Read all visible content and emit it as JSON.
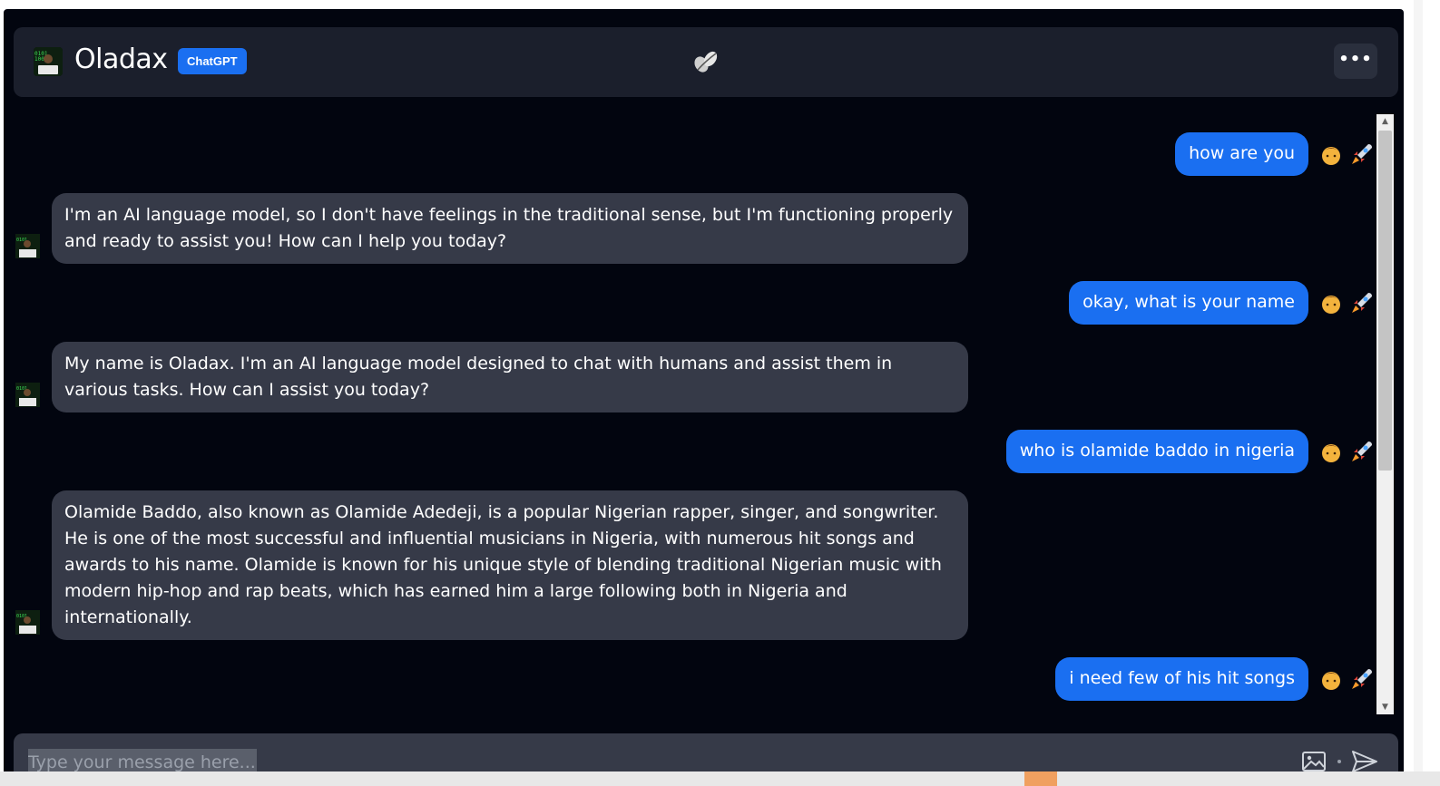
{
  "header": {
    "title": "Oladax",
    "badge": "ChatGPT",
    "menu_label": "•••"
  },
  "messages": [
    {
      "role": "user",
      "text": "how are you"
    },
    {
      "role": "bot",
      "text": "I'm an AI language model, so I don't have feelings in the traditional sense, but I'm functioning properly and ready to assist you! How can I help you today?"
    },
    {
      "role": "user",
      "text": "okay, what is your name"
    },
    {
      "role": "bot",
      "text": "My name is Oladax. I'm an AI language model designed to chat with humans and assist them in various tasks. How can I assist you today?"
    },
    {
      "role": "user",
      "text": "who is olamide baddo in nigeria"
    },
    {
      "role": "bot",
      "text": "Olamide Baddo, also known as Olamide Adedeji, is a popular Nigerian rapper, singer, and songwriter. He is one of the most successful and influential musicians in Nigeria, with numerous hit songs and awards to his name. Olamide is known for his unique style of blending traditional Nigerian music with modern hip-hop and rap beats, which has earned him a large following both in Nigeria and internationally."
    },
    {
      "role": "user",
      "text": "i need few of his hit songs"
    }
  ],
  "composer": {
    "placeholder": "Type your message here..."
  },
  "icons": {
    "logo": "robot-laptop-logo",
    "center": "seed-leaf-icon",
    "user_avatar": "boy-emoji",
    "user_status": "rocket-emoji",
    "image": "image-icon",
    "send": "send-icon"
  },
  "colors": {
    "background": "#02050f",
    "header": "#1b1f2c",
    "accent": "#1a6ff1",
    "bot_bubble": "#363a48"
  }
}
